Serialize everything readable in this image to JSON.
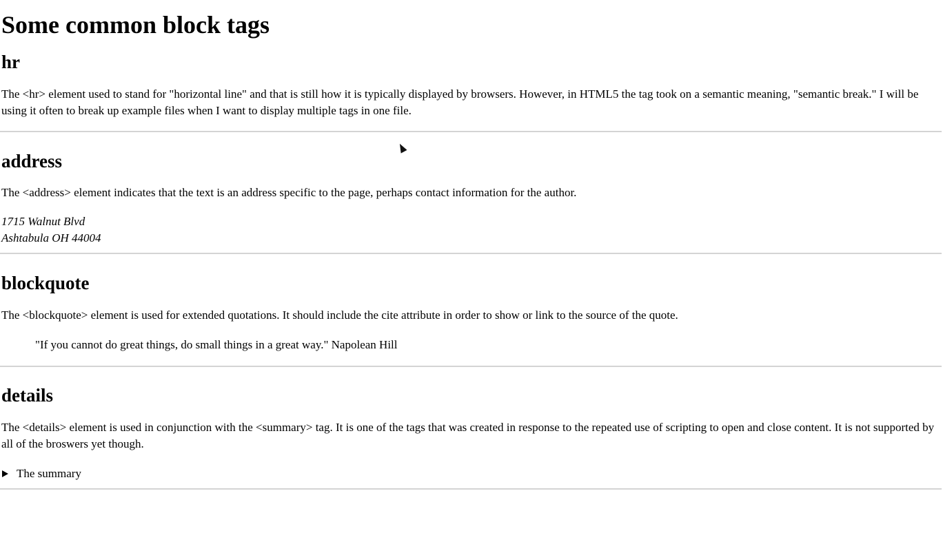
{
  "title": "Some common block tags",
  "sections": {
    "hr": {
      "heading": "hr",
      "text": "The <hr> element used to stand for \"horizontal line\" and that is still how it is typically displayed by browsers. However, in HTML5 the tag took on a semantic meaning, \"semantic break.\" I will be using it often to break up example files when I want to display multiple tags in one file."
    },
    "address": {
      "heading": "address",
      "text": "The <address> element indicates that the text is an address specific to the page, perhaps contact information for the author.",
      "line1": "1715 Walnut Blvd",
      "line2": "Ashtabula OH 44004"
    },
    "blockquote": {
      "heading": "blockquote",
      "text": "The <blockquote> element is used for extended quotations. It should include the cite attribute in order to show or link to the source of the quote.",
      "quote": "\"If you cannot do great things, do small things in a great way.\" Napolean Hill"
    },
    "details": {
      "heading": "details",
      "text": "The <details> element is used in conjunction with the <summary> tag. It is one of the tags that was created in response to the repeated use of scripting to open and close content. It is not supported by all of the broswers yet though.",
      "summary": "The summary"
    }
  }
}
